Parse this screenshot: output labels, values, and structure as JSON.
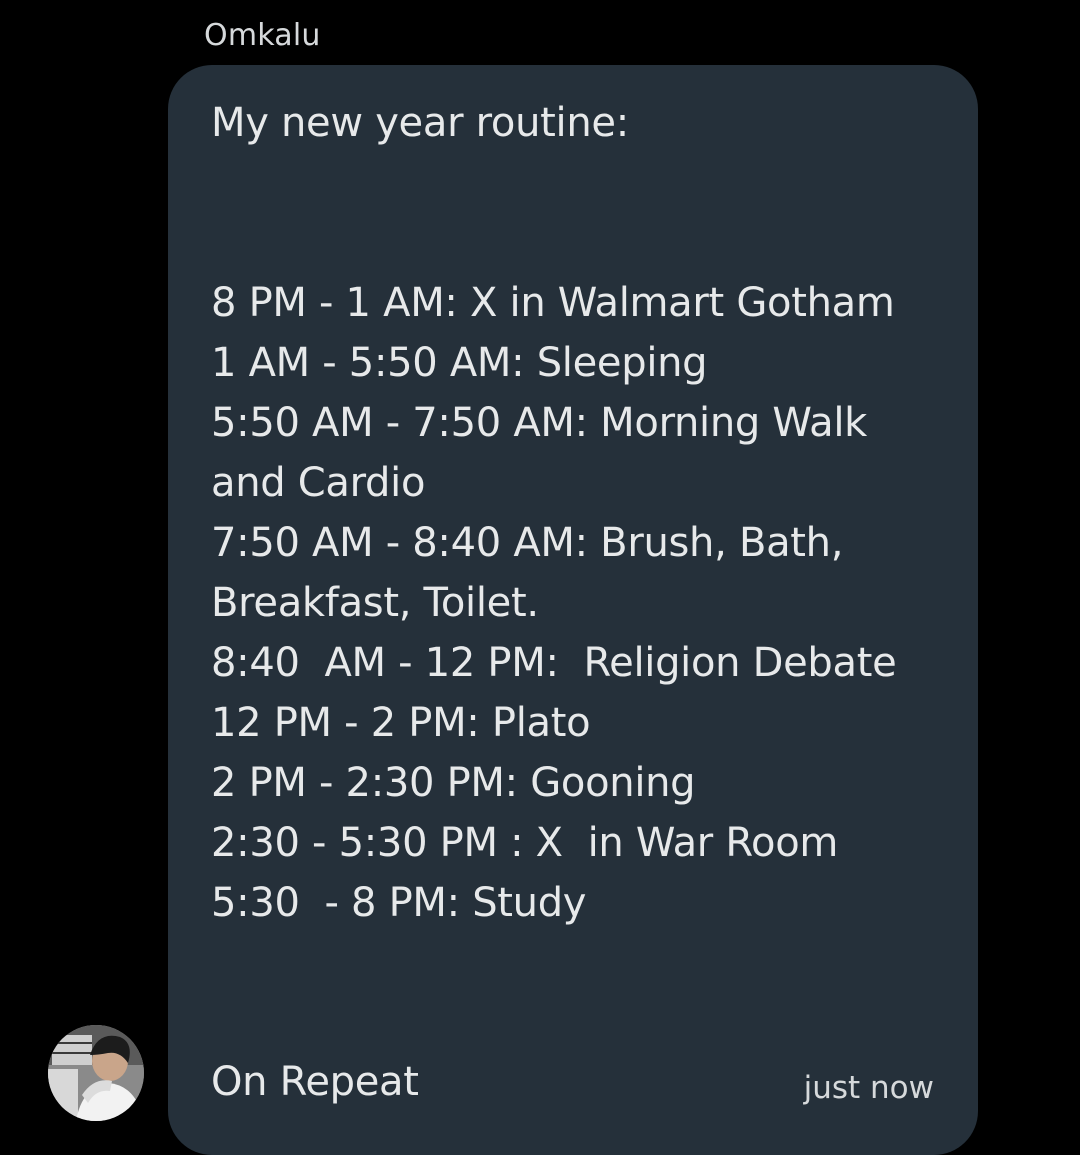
{
  "message": {
    "sender": "Omkalu",
    "heading": "My new year routine:",
    "lines": [
      "8 PM - 1 AM: X in Walmart Gotham",
      "1 AM - 5:50 AM: Sleeping",
      "5:50 AM - 7:50 AM: Morning Walk",
      "and Cardio",
      "7:50 AM - 8:40 AM: Brush, Bath,",
      "Breakfast, Toilet.",
      "8:40  AM - 12 PM:  Religion Debate",
      "12 PM - 2 PM: Plato",
      "2 PM - 2:30 PM: Gooning",
      "2:30 - 5:30 PM : X  in War Room",
      "5:30  - 8 PM: Study"
    ],
    "footer": "On Repeat",
    "timestamp": "just now",
    "avatar_icon": "user-photo-avatar"
  },
  "colors": {
    "background": "#000000",
    "bubble": "#25303a",
    "text": "#e7e9ea"
  }
}
